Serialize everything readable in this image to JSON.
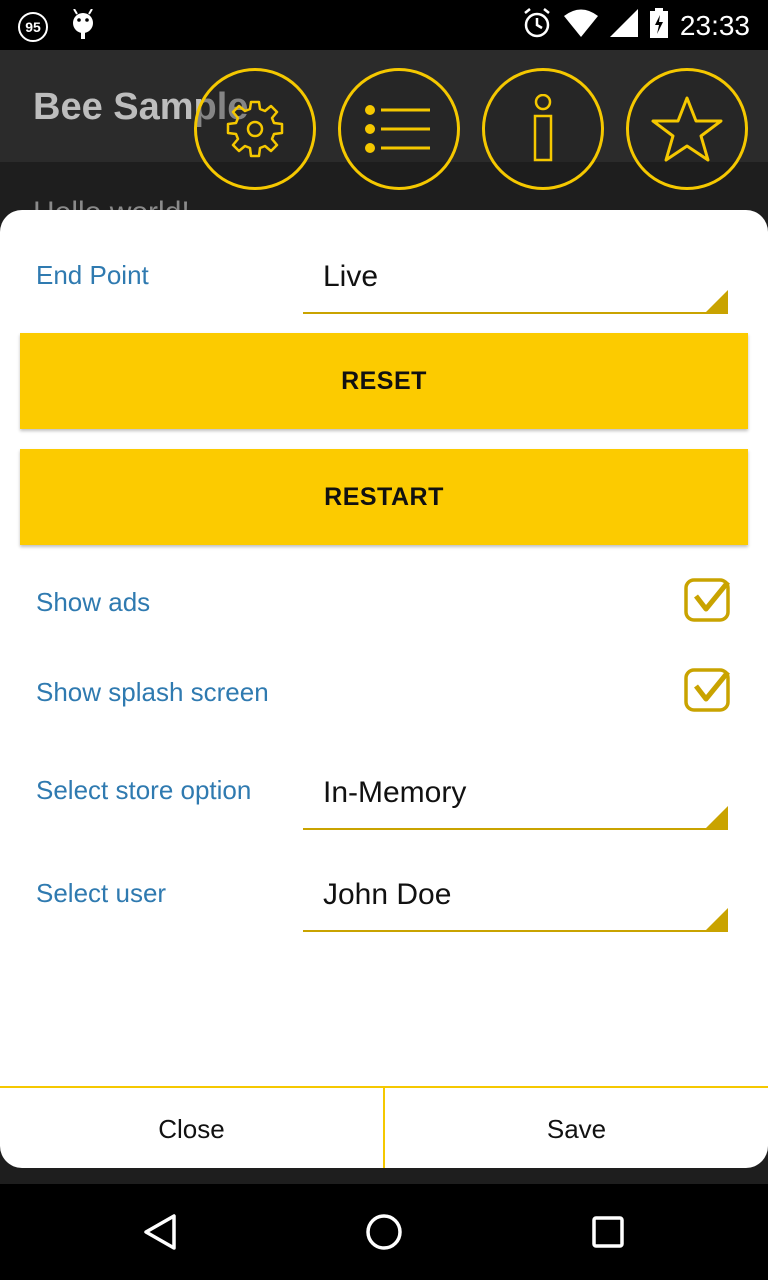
{
  "status_bar": {
    "notification_count": "95",
    "time": "23:33"
  },
  "app": {
    "title": "Bee Sample",
    "background_text": "Hello world!"
  },
  "toolbar_icons": [
    "gear-icon",
    "list-icon",
    "info-icon",
    "star-icon"
  ],
  "dialog": {
    "end_point": {
      "label": "End Point",
      "value": "Live"
    },
    "reset_label": "RESET",
    "restart_label": "RESTART",
    "show_ads": {
      "label": "Show ads",
      "checked": true
    },
    "show_splash": {
      "label": "Show splash screen",
      "checked": true
    },
    "store_option": {
      "label": "Select store option",
      "value": "In-Memory"
    },
    "user": {
      "label": "Select user",
      "value": "John Doe"
    },
    "close_label": "Close",
    "save_label": "Save"
  },
  "colors": {
    "accent": "#fccb00",
    "label_blue": "#2f7ab0",
    "underline": "#c9a300"
  }
}
